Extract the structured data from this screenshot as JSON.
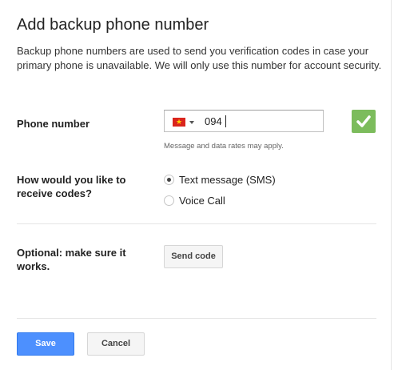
{
  "dialog": {
    "title": "Add backup phone number",
    "description": "Backup phone numbers are used to send you verification codes in case your primary phone is unavailable. We will only use this number for account security."
  },
  "phone": {
    "label": "Phone number",
    "country_flag_icon": "vietnam-flag-icon",
    "value": "094",
    "helper_text": "Message and data rates may apply.",
    "verified_icon": "checkmark-icon",
    "verified_color": "#7cbc5c"
  },
  "delivery": {
    "label": "How would you like to receive codes?",
    "options": [
      {
        "label": "Text message (SMS)",
        "selected": true
      },
      {
        "label": "Voice Call",
        "selected": false
      }
    ]
  },
  "test": {
    "label": "Optional: make sure it works.",
    "send_code_label": "Send code"
  },
  "actions": {
    "save_label": "Save",
    "cancel_label": "Cancel",
    "save_color": "#4d90fe"
  }
}
